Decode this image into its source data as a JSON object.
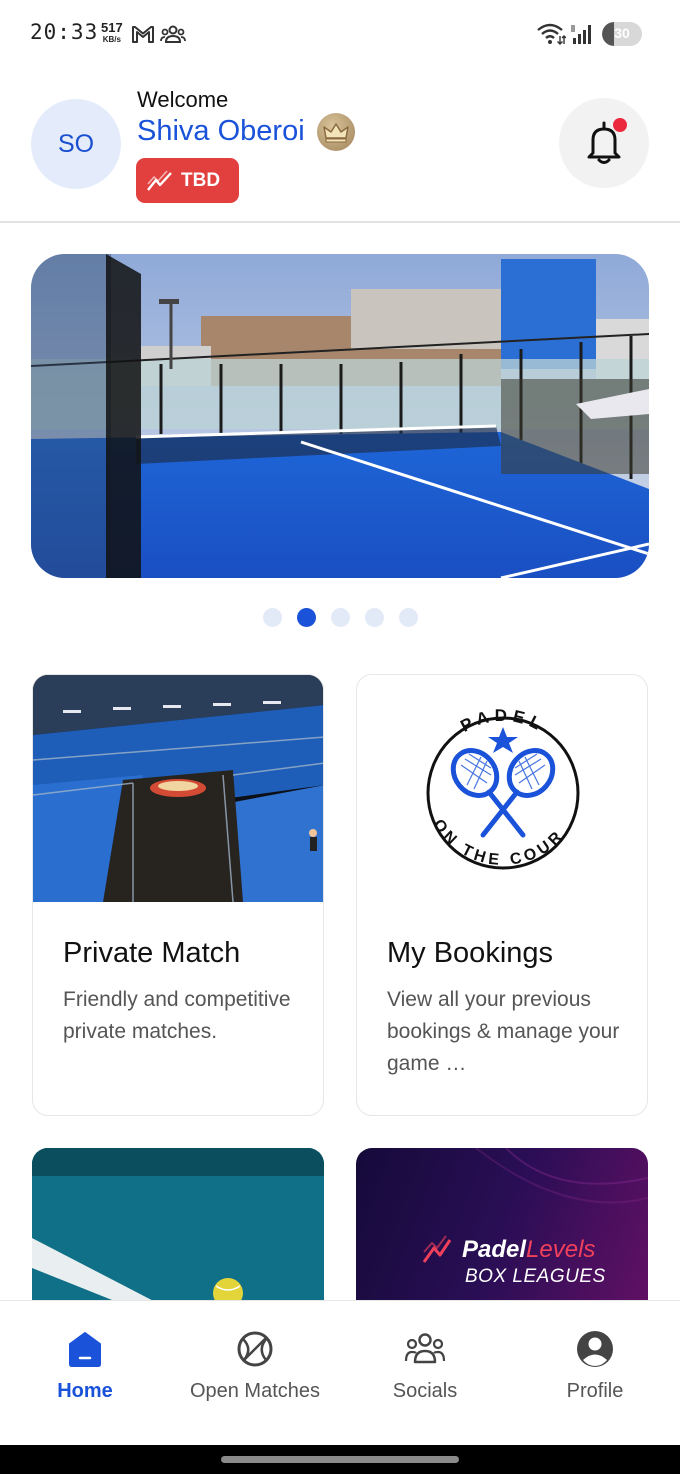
{
  "status_bar": {
    "time": "20:33",
    "net_speed": "517",
    "net_unit": "KB/s",
    "battery_level": "30",
    "battery_fraction": 0.3,
    "icons": [
      "gmail-icon",
      "people-icon",
      "wifi-icon",
      "signal-icon",
      "battery-icon"
    ]
  },
  "header": {
    "avatar_initials": "SO",
    "welcome": "Welcome",
    "user_name": "Shiva Oberoi",
    "level_label": "TBD",
    "has_notification": true
  },
  "carousel": {
    "total_slides": 5,
    "active_index": 1
  },
  "cards": [
    {
      "title": "Private Match",
      "description": "Friendly and competitive private matches."
    },
    {
      "title": "My Bookings",
      "description": "View all your previous bookings & manage your game …",
      "logo_top": "PADEL",
      "logo_bottom": "ON THE COURT"
    }
  ],
  "promo": {
    "brand_prefix": "Padel",
    "brand_suffix": "Levels",
    "subtitle": "BOX LEAGUES"
  },
  "nav": {
    "items": [
      {
        "label": "Home",
        "icon": "home-icon",
        "active": true
      },
      {
        "label": "Open Matches",
        "icon": "tennis-ball-icon",
        "active": false
      },
      {
        "label": "Socials",
        "icon": "group-icon",
        "active": false
      },
      {
        "label": "Profile",
        "icon": "profile-icon",
        "active": false
      }
    ]
  },
  "colors": {
    "primary": "#1a53d9",
    "badge_red": "#e2403f",
    "notification_dot": "#ec2a3d",
    "court_blue": "#1f6fe0"
  }
}
